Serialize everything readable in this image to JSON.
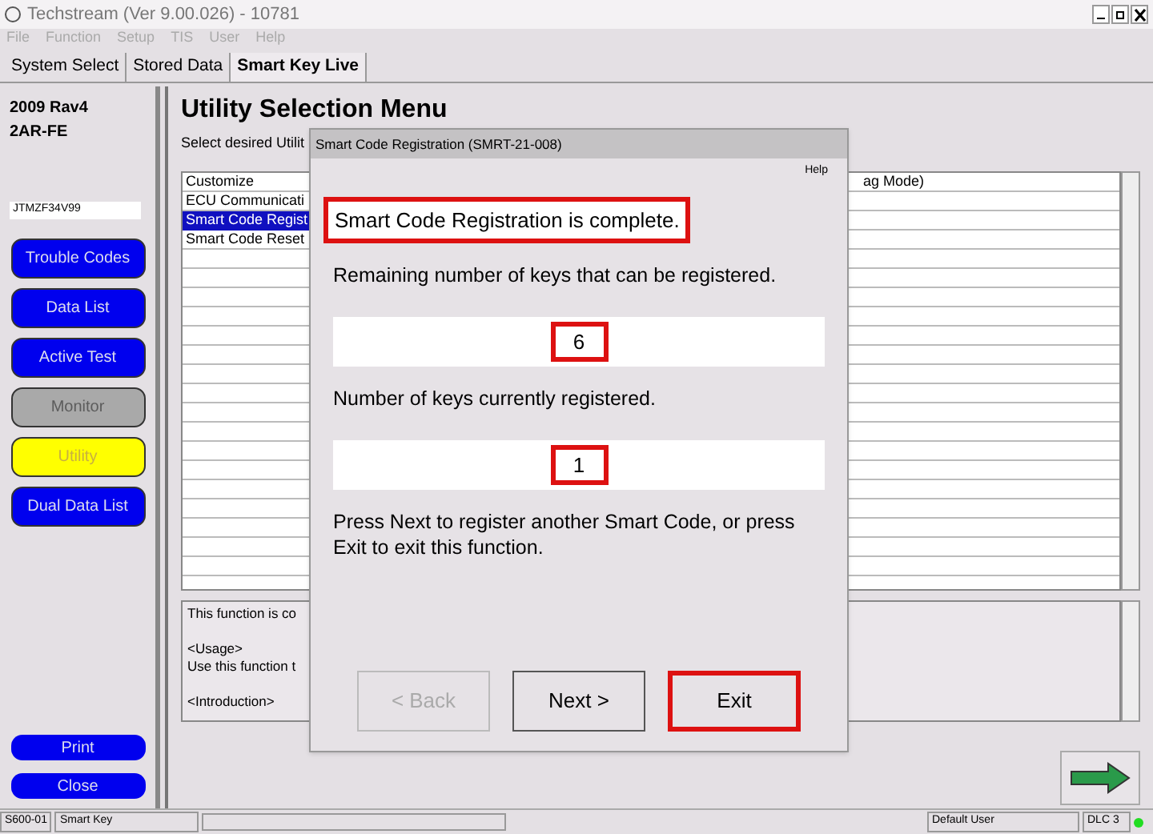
{
  "window": {
    "title": "Techstream (Ver 9.00.026) - 10781"
  },
  "menu": [
    {
      "label": "File",
      "disabled": true
    },
    {
      "label": "Function",
      "disabled": true
    },
    {
      "label": "Setup",
      "disabled": true
    },
    {
      "label": "TIS",
      "disabled": true
    },
    {
      "label": "User",
      "disabled": true
    },
    {
      "label": "Help",
      "disabled": true
    }
  ],
  "tabs": [
    {
      "label": "System Select",
      "selected": false
    },
    {
      "label": "Stored Data",
      "selected": false
    },
    {
      "label": "Smart Key Live",
      "selected": true
    }
  ],
  "vehicle": {
    "model": "2009 Rav4",
    "engine": "2AR-FE",
    "vin": "JTMZF34V99"
  },
  "side_buttons": [
    {
      "label": "Trouble Codes",
      "kind": "normal"
    },
    {
      "label": "Data List",
      "kind": "normal"
    },
    {
      "label": "Active Test",
      "kind": "normal"
    },
    {
      "label": "Monitor",
      "kind": "disabled"
    },
    {
      "label": "Utility",
      "kind": "active"
    },
    {
      "label": "Dual Data List",
      "kind": "normal"
    }
  ],
  "bottom_buttons": [
    "Print",
    "Close"
  ],
  "main": {
    "heading": "Utility Selection Menu",
    "instruction": "Select desired Utilit",
    "list": [
      {
        "column_1": "Customize",
        "column_2": "ag Mode)",
        "selected": false
      },
      {
        "column_1": "ECU Communicati",
        "selected": false
      },
      {
        "column_1": "Smart Code Regist",
        "selected": true
      },
      {
        "column_1": "Smart Code Reset",
        "selected": false
      }
    ],
    "description": [
      [
        "This function is co"
      ],
      [
        "<Usage>",
        "Use this function t"
      ],
      [
        "<Introduction>"
      ]
    ]
  },
  "dialog": {
    "title": "Smart Code Registration (SMRT-21-008)",
    "help": "Help",
    "items": [
      {
        "kind": "message",
        "text": "Smart Code Registration is complete.",
        "highlighted": true
      },
      {
        "kind": "label",
        "text": "Remaining number of keys that can be registered."
      },
      {
        "kind": "value",
        "text": "6",
        "highlighted": true
      },
      {
        "kind": "label",
        "text": "Number of keys currently registered."
      },
      {
        "kind": "value",
        "text": "1",
        "highlighted": true
      },
      {
        "kind": "label",
        "text": "Press Next to register another Smart Code, or press Exit to exit this function."
      }
    ],
    "buttons": [
      {
        "label": "< Back",
        "disabled": true,
        "highlighted": false
      },
      {
        "label": "Next >",
        "disabled": false,
        "highlighted": false
      },
      {
        "label": "Exit",
        "disabled": false,
        "highlighted": true
      }
    ]
  },
  "status_bar": {
    "code": "S600-01",
    "system": "Smart Key",
    "user": "Default User",
    "connection": "DLC 3",
    "connected": true
  }
}
